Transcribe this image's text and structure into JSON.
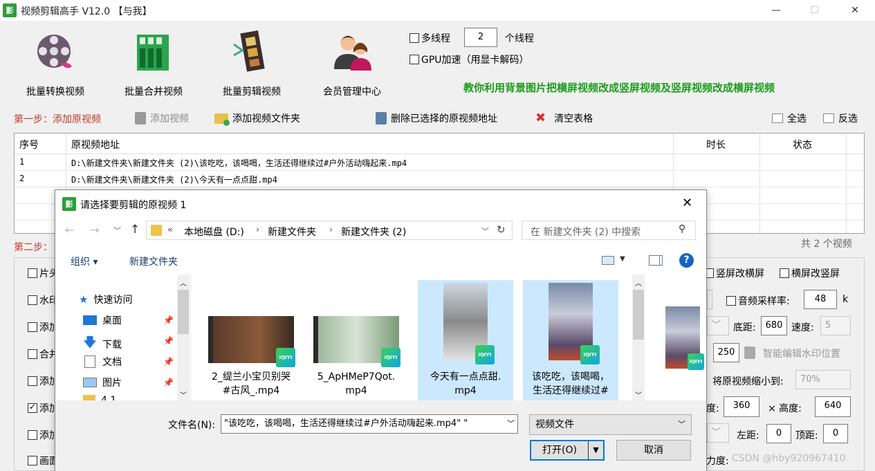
{
  "window": {
    "title": "视频剪辑高手 V12.0 【与我】",
    "icon_text": "影",
    "min": "—",
    "max": "☐",
    "close": "✕"
  },
  "toolbar": {
    "tools": [
      {
        "label": "批量转换视频",
        "icon": "film-reel-icon"
      },
      {
        "label": "批量合并视频",
        "icon": "film-merge-icon"
      },
      {
        "label": "批量剪辑视频",
        "icon": "film-cut-icon"
      },
      {
        "label": "会员管理中心",
        "icon": "users-icon"
      }
    ],
    "multithread_label": "多线程",
    "multithread_checked": false,
    "threads_value": "2",
    "threads_suffix": "个线程",
    "gpu_label": "GPU加速（用显卡解码）",
    "gpu_checked": false,
    "promo_link": "教你利用背景图片把横屏视频改成竖屏视频及竖屏视频改成横屏视频"
  },
  "step1": {
    "title": "第一步：添加原视频",
    "add_video": "添加视频",
    "add_folder": "添加视频文件夹",
    "delete_selected": "删除已选择的原视频地址",
    "clear_table": "清空表格",
    "select_all": "全选",
    "invert": "反选"
  },
  "table": {
    "headers": {
      "index": "序号",
      "path": "原视频地址",
      "duration": "时长",
      "status": "状态"
    },
    "rows": [
      {
        "index": "1",
        "path": "D:\\新建文件夹\\新建文件夹 (2)\\该吃吃，该喝喝，生活还得继续过#户外活动嗨起来.mp4",
        "duration": "",
        "status": ""
      },
      {
        "index": "2",
        "path": "D:\\新建文件夹\\新建文件夹 (2)\\今天有一点点甜.mp4",
        "duration": "",
        "status": ""
      }
    ],
    "count_text": "共 2 个视频"
  },
  "step2": {
    "title": "第二步：",
    "left_items": [
      {
        "label": "片头",
        "checked": false
      },
      {
        "label": "水印",
        "checked": false
      },
      {
        "label": "添加",
        "checked": false
      },
      {
        "label": "合并",
        "checked": false
      },
      {
        "label": "添加",
        "checked": false
      },
      {
        "label": "添加",
        "checked": true
      },
      {
        "label": "添加",
        "checked": false
      },
      {
        "label": "画面",
        "checked": false
      }
    ],
    "vert_to_horiz": "竖屏改横屏",
    "horiz_to_vert": "横屏改竖屏",
    "audio_rate_label": "音频采样率:",
    "audio_rate_value": "48",
    "audio_rate_unit": "k",
    "bottom_margin_label": "底距:",
    "bottom_margin_value": "680",
    "speed_label": "速度:",
    "speed_value": "5",
    "field_250": "250",
    "smart_watermark": "智能编辑水印位置",
    "shrink_label": "将原视频缩小到:",
    "shrink_value": "70%",
    "width_label": "度:",
    "width_value": "360",
    "height_label": "× 高度:",
    "height_value": "640",
    "left_margin_label": "左距:",
    "left_margin_value": "0",
    "top_margin_label": "顶距:",
    "top_margin_value": "0",
    "strength_label": "力度:",
    "watermark_text": "CSDN @hby920967410"
  },
  "dialog": {
    "title": "请选择要剪辑的原视频 1",
    "close": "✕",
    "breadcrumb": [
      "«",
      "本地磁盘 (D:)",
      "新建文件夹",
      "新建文件夹 (2)"
    ],
    "search_placeholder": "在 新建文件夹 (2) 中搜索",
    "organize": "组织 ▾",
    "new_folder": "新建文件夹",
    "help": "?",
    "nav": [
      {
        "label": "快速访问",
        "icon": "star-icon"
      },
      {
        "label": "桌面",
        "icon": "desktop-icon"
      },
      {
        "label": "下载",
        "icon": "download-icon"
      },
      {
        "label": "文档",
        "icon": "document-icon"
      },
      {
        "label": "图片",
        "icon": "picture-icon"
      },
      {
        "label": "4.1",
        "icon": "folder-icon"
      }
    ],
    "files": [
      {
        "name1": "2_缇兰小宝贝别哭",
        "name2": "#古风_.mp4",
        "selected": false
      },
      {
        "name1": "5_ApHMeP7Qot.",
        "name2": "mp4",
        "selected": false
      },
      {
        "name1": "今天有一点点甜.",
        "name2": "mp4",
        "selected": true
      },
      {
        "name1": "该吃吃，该喝喝，",
        "name2": "生活还得继续过#",
        "selected": true
      }
    ],
    "filename_label": "文件名(N):",
    "filename_value": "\"该吃吃，该喝喝，生活还得继续过#户外活动嗨起来.mp4\" \"",
    "filetype_value": "视频文件",
    "open_button": "打开(O)",
    "cancel_button": "取消",
    "iqiyi": "iQIYI"
  }
}
